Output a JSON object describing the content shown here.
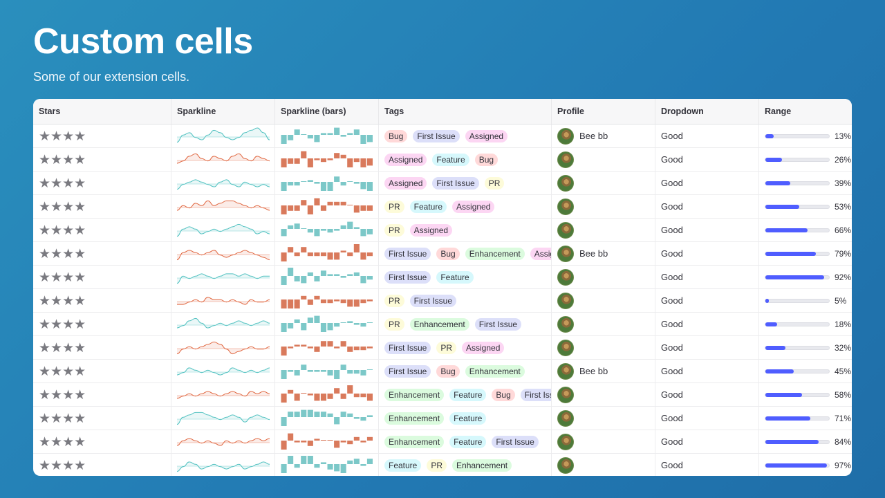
{
  "page": {
    "title": "Custom cells",
    "subtitle": "Some of our extension cells."
  },
  "columns": [
    "Stars",
    "Sparkline",
    "Sparkline (bars)",
    "Tags",
    "Profile",
    "Dropdown",
    "Range"
  ],
  "stars_glyph": "★★★★",
  "colors": {
    "spark_teal": "#4fc1c0",
    "spark_orange": "#e0663f",
    "bar_teal": "#7cc8c8",
    "bar_orange": "#d97a5c",
    "range_fill": "#4f5dff",
    "tag_colors": {
      "Bug": "#ffd9d9",
      "First Issue": "#dcdff9",
      "Assigned": "#fcd6f3",
      "Feature": "#d6f8fc",
      "PR": "#fdfbd9",
      "Enhancement": "#dbfbde"
    }
  },
  "rows": [
    {
      "spark": "teal",
      "bars": "teal",
      "tags": [
        "Bug",
        "First Issue",
        "Assigned"
      ],
      "profile_name": "Bee bb",
      "dropdown": "Good",
      "range": 13,
      "range_text": "13%",
      "spark_values": [
        2,
        5,
        6,
        4,
        3,
        5,
        7,
        6,
        4,
        3,
        4,
        6,
        7,
        8,
        6,
        3
      ],
      "bar_values": [
        -5,
        -3,
        3,
        0,
        -2,
        -4,
        1,
        1,
        4,
        -1,
        1,
        3,
        -5,
        -4
      ]
    },
    {
      "spark": "orange",
      "bars": "orange",
      "tags": [
        "Assigned",
        "Feature",
        "Bug"
      ],
      "profile_name": "",
      "dropdown": "Good",
      "range": 26,
      "range_text": "26%",
      "spark_values": [
        3,
        4,
        6,
        7,
        5,
        4,
        6,
        5,
        4,
        6,
        7,
        5,
        4,
        6,
        5,
        4
      ],
      "bar_values": [
        -5,
        -3,
        -3,
        4,
        -5,
        -1,
        -2,
        -1,
        3,
        2,
        -5,
        -2,
        -5,
        -4
      ]
    },
    {
      "spark": "teal",
      "bars": "teal",
      "tags": [
        "Assigned",
        "First Issue",
        "PR"
      ],
      "profile_name": "",
      "dropdown": "Good",
      "range": 39,
      "range_text": "39%",
      "spark_values": [
        2,
        4,
        5,
        6,
        5,
        4,
        3,
        5,
        6,
        4,
        3,
        5,
        4,
        3,
        4,
        3
      ],
      "bar_values": [
        -5,
        -2,
        -2,
        0,
        1,
        -1,
        -5,
        -5,
        3,
        -2,
        0,
        -1,
        -4,
        -5
      ]
    },
    {
      "spark": "orange",
      "bars": "orange",
      "tags": [
        "PR",
        "Feature",
        "Assigned"
      ],
      "profile_name": "",
      "dropdown": "Good",
      "range": 53,
      "range_text": "53%",
      "spark_values": [
        3,
        5,
        4,
        6,
        5,
        7,
        5,
        6,
        7,
        7,
        6,
        5,
        4,
        5,
        4,
        3
      ],
      "bar_values": [
        -5,
        -3,
        -3,
        3,
        -5,
        4,
        -3,
        2,
        2,
        2,
        0,
        -4,
        -3,
        -3
      ]
    },
    {
      "spark": "teal",
      "bars": "teal",
      "tags": [
        "PR",
        "Assigned"
      ],
      "profile_name": "",
      "dropdown": "Good",
      "range": 66,
      "range_text": "66%",
      "spark_values": [
        2,
        5,
        6,
        5,
        3,
        4,
        5,
        4,
        5,
        6,
        7,
        6,
        5,
        3,
        4,
        3
      ],
      "bar_values": [
        -4,
        2,
        3,
        0,
        -2,
        -4,
        -1,
        -2,
        -1,
        2,
        4,
        1,
        -4,
        -3
      ]
    },
    {
      "spark": "orange",
      "bars": "orange",
      "tags": [
        "First Issue",
        "Bug",
        "Enhancement",
        "Assigned"
      ],
      "profile_name": "Bee bb",
      "dropdown": "Good",
      "range": 79,
      "range_text": "79%",
      "spark_values": [
        2,
        5,
        6,
        5,
        4,
        5,
        6,
        4,
        3,
        4,
        5,
        6,
        5,
        4,
        3,
        2
      ],
      "bar_values": [
        -5,
        3,
        -2,
        3,
        -2,
        -2,
        -2,
        -4,
        -4,
        1,
        -2,
        5,
        -4,
        -2
      ]
    },
    {
      "spark": "teal",
      "bars": "teal",
      "tags": [
        "First Issue",
        "Feature"
      ],
      "profile_name": "",
      "dropdown": "Good",
      "range": 92,
      "range_text": "92%",
      "spark_values": [
        2,
        5,
        4,
        5,
        6,
        5,
        4,
        5,
        6,
        6,
        5,
        6,
        5,
        4,
        5,
        5
      ],
      "bar_values": [
        -5,
        5,
        -3,
        -4,
        2,
        -3,
        3,
        1,
        1,
        -1,
        1,
        2,
        -4,
        -2
      ]
    },
    {
      "spark": "orange",
      "bars": "orange",
      "tags": [
        "PR",
        "First Issue"
      ],
      "profile_name": "",
      "dropdown": "Good",
      "range": 5,
      "range_text": "5%",
      "spark_values": [
        3,
        3,
        4,
        5,
        4,
        6,
        5,
        5,
        4,
        5,
        4,
        3,
        5,
        4,
        4,
        5
      ],
      "bar_values": [
        -5,
        -5,
        -5,
        2,
        -3,
        2,
        -2,
        -2,
        -1,
        -2,
        -4,
        -4,
        -2,
        -1
      ]
    },
    {
      "spark": "teal",
      "bars": "teal",
      "tags": [
        "PR",
        "Enhancement",
        "First Issue"
      ],
      "profile_name": "",
      "dropdown": "Good",
      "range": 18,
      "range_text": "18%",
      "spark_values": [
        3,
        4,
        6,
        7,
        5,
        3,
        4,
        5,
        4,
        5,
        6,
        5,
        4,
        5,
        6,
        5
      ],
      "bar_values": [
        -5,
        -3,
        2,
        -4,
        3,
        4,
        -5,
        -4,
        -2,
        0,
        1,
        -1,
        -2,
        0
      ]
    },
    {
      "spark": "orange",
      "bars": "orange",
      "tags": [
        "First Issue",
        "PR",
        "Assigned"
      ],
      "profile_name": "",
      "dropdown": "Good",
      "range": 32,
      "range_text": "32%",
      "spark_values": [
        2,
        4,
        5,
        4,
        5,
        6,
        7,
        6,
        4,
        2,
        3,
        4,
        5,
        4,
        4,
        5
      ],
      "bar_values": [
        -5,
        -1,
        1,
        1,
        -1,
        -3,
        3,
        3,
        -1,
        3,
        -3,
        -2,
        -2,
        -1
      ]
    },
    {
      "spark": "teal",
      "bars": "teal",
      "tags": [
        "First Issue",
        "Bug",
        "Enhancement"
      ],
      "profile_name": "Bee bb",
      "dropdown": "Good",
      "range": 45,
      "range_text": "45%",
      "spark_values": [
        3,
        4,
        6,
        5,
        4,
        5,
        4,
        3,
        4,
        6,
        5,
        4,
        5,
        4,
        5,
        6
      ],
      "bar_values": [
        -5,
        -1,
        -3,
        3,
        -1,
        -1,
        -1,
        -3,
        -5,
        3,
        -2,
        -2,
        -3,
        0
      ]
    },
    {
      "spark": "orange",
      "bars": "orange",
      "tags": [
        "Enhancement",
        "Feature",
        "Bug",
        "First Issue"
      ],
      "profile_name": "",
      "dropdown": "Good",
      "range": 58,
      "range_text": "58%",
      "spark_values": [
        3,
        4,
        5,
        4,
        5,
        6,
        5,
        4,
        5,
        6,
        5,
        4,
        6,
        5,
        6,
        5
      ],
      "bar_values": [
        -5,
        2,
        -4,
        0,
        -1,
        -4,
        -4,
        -3,
        3,
        -3,
        5,
        -2,
        -2,
        -4
      ]
    },
    {
      "spark": "teal",
      "bars": "teal",
      "tags": [
        "Enhancement",
        "Feature"
      ],
      "profile_name": "",
      "dropdown": "Good",
      "range": 71,
      "range_text": "71%",
      "spark_values": [
        2,
        5,
        6,
        7,
        7,
        6,
        5,
        4,
        5,
        6,
        5,
        3,
        5,
        6,
        5,
        4
      ],
      "bar_values": [
        -5,
        3,
        3,
        4,
        4,
        3,
        3,
        2,
        -4,
        3,
        2,
        -1,
        -2,
        1
      ]
    },
    {
      "spark": "orange",
      "bars": "orange",
      "tags": [
        "Enhancement",
        "Feature",
        "First Issue"
      ],
      "profile_name": "",
      "dropdown": "Good",
      "range": 84,
      "range_text": "84%",
      "spark_values": [
        3,
        5,
        6,
        5,
        4,
        5,
        4,
        3,
        5,
        4,
        5,
        4,
        5,
        6,
        5,
        6
      ],
      "bar_values": [
        -5,
        4,
        -1,
        -1,
        -3,
        1,
        0,
        0,
        -4,
        -1,
        -2,
        2,
        -1,
        2
      ]
    },
    {
      "spark": "teal",
      "bars": "teal",
      "tags": [
        "Feature",
        "PR",
        "Enhancement"
      ],
      "profile_name": "",
      "dropdown": "Good",
      "range": 97,
      "range_text": "97%",
      "spark_values": [
        2,
        4,
        6,
        5,
        3,
        4,
        5,
        4,
        3,
        4,
        5,
        3,
        4,
        5,
        6,
        5
      ],
      "bar_values": [
        -5,
        5,
        -2,
        5,
        5,
        -2,
        1,
        -3,
        -4,
        -5,
        2,
        3,
        -1,
        3
      ]
    }
  ]
}
